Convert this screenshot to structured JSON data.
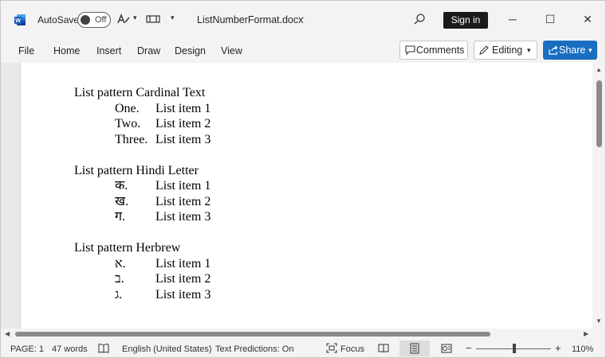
{
  "titlebar": {
    "autosave_label": "AutoSave",
    "autosave_state": "Off",
    "doc_title": "ListNumberFormat.docx",
    "signin_label": "Sign in"
  },
  "ribbon": {
    "tabs": [
      "File",
      "Home",
      "Insert",
      "Draw",
      "Design",
      "View"
    ],
    "comments_label": "Comments",
    "editing_label": "Editing",
    "share_label": "Share"
  },
  "document": {
    "groups": [
      {
        "title": "List pattern Cardinal Text",
        "items": [
          {
            "number": "One.",
            "text": "List item 1"
          },
          {
            "number": "Two.",
            "text": "List item 2"
          },
          {
            "number": "Three.",
            "text": "List item 3"
          }
        ]
      },
      {
        "title": "List pattern Hindi Letter",
        "items": [
          {
            "number": "क.",
            "text": "List item 1"
          },
          {
            "number": "ख.",
            "text": "List item 2"
          },
          {
            "number": "ग.",
            "text": "List item 3"
          }
        ]
      },
      {
        "title": "List pattern Herbrew",
        "items": [
          {
            "number": "א.",
            "text": "List item 1"
          },
          {
            "number": "ב.",
            "text": "List item 2"
          },
          {
            "number": "ג.",
            "text": "List item 3"
          }
        ]
      }
    ]
  },
  "statusbar": {
    "page": "PAGE: 1",
    "words": "47 words",
    "language": "English (United States)",
    "text_predictions": "Text Predictions: On",
    "focus": "Focus",
    "zoom_level": "110%",
    "zoom_minus": "−",
    "zoom_plus": "+"
  },
  "colors": {
    "accent": "#1a6ec2",
    "word_blue": "#185abd"
  }
}
